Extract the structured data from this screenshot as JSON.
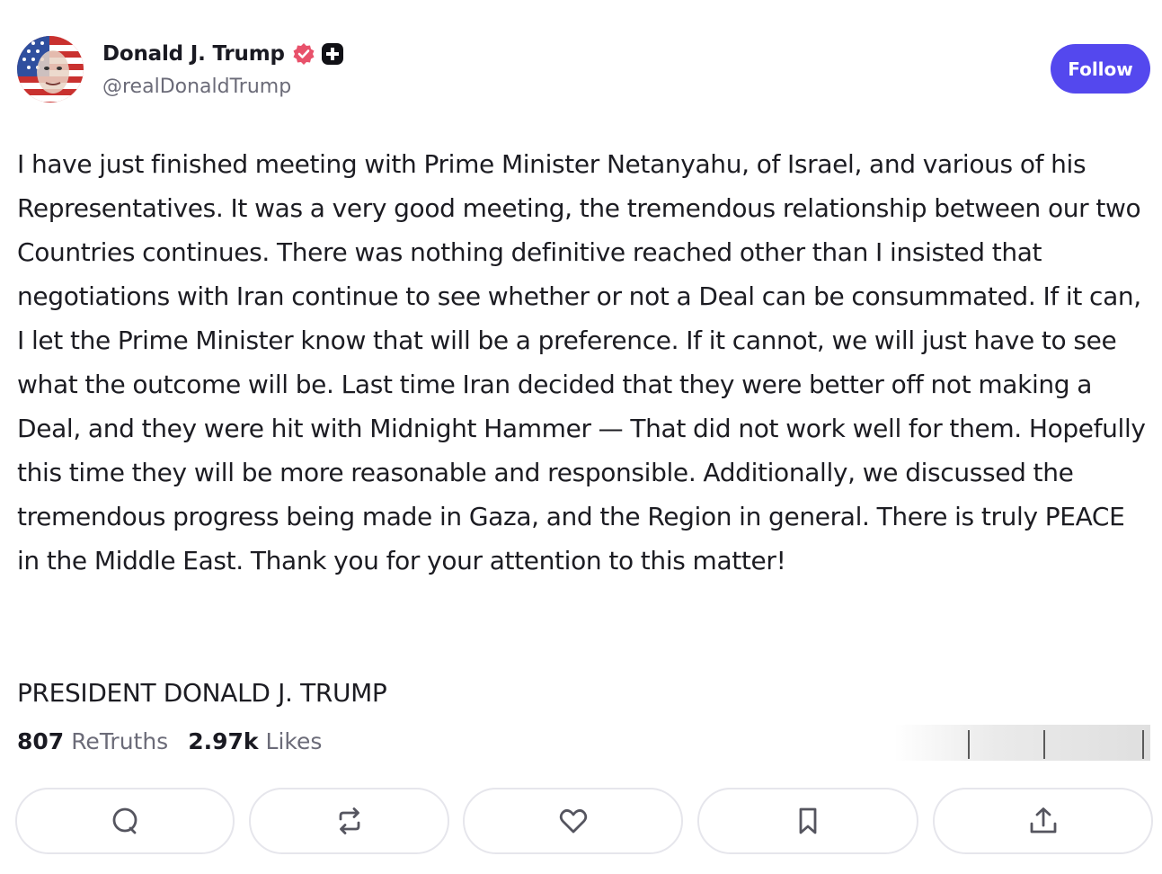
{
  "author": {
    "display_name": "Donald J. Trump",
    "handle": "@realDonaldTrump",
    "verified_badge_color": "#e8526b",
    "plus_badge_color": "#111116"
  },
  "follow": {
    "label": "Follow",
    "color": "#5448ee"
  },
  "post": {
    "body": "I have just finished meeting with Prime Minister Netanyahu, of Israel, and various of his Representatives. It was a very good meeting, the tremendous relationship between our two Countries continues. There was nothing definitive reached other than I insisted that negotiations with Iran continue to see whether or not a Deal can be consummated. If it can, I let the Prime Minister know that will be a preference. If it cannot, we will just have to see what the outcome will be. Last time Iran decided that they were better off not making a Deal, and they were hit with Midnight Hammer — That did not work well for them. Hopefully this time they will be more reasonable and responsible. Additionally, we discussed the tremendous progress being made in Gaza, and the Region in general. There is truly PEACE in the Middle East. Thank you for your attention to this matter!",
    "signature": "PRESIDENT DONALD J. TRUMP"
  },
  "stats": {
    "retruths_count": "807",
    "retruths_label": "ReTruths",
    "likes_count": "2.97k",
    "likes_label": "Likes"
  },
  "actions": [
    {
      "name": "reply",
      "icon": "speech-bubble-icon"
    },
    {
      "name": "retruth",
      "icon": "repost-arrows-icon"
    },
    {
      "name": "like",
      "icon": "heart-icon"
    },
    {
      "name": "bookmark",
      "icon": "bookmark-icon"
    },
    {
      "name": "share",
      "icon": "share-upload-icon"
    }
  ],
  "colors": {
    "text": "#1c1c22",
    "muted": "#6b6b78",
    "border": "#e6e6ec"
  }
}
